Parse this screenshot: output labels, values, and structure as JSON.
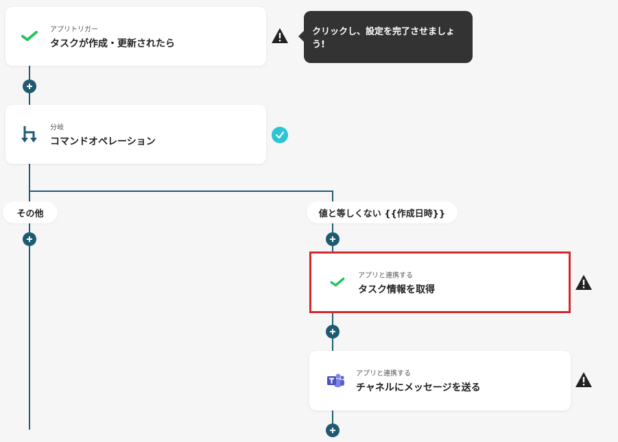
{
  "trigger": {
    "sublabel": "アプリトリガー",
    "title": "タスクが作成・更新されたら",
    "icon": "jooto-check-icon"
  },
  "tooltip": {
    "text": "クリックし、設定を完了させましょう!"
  },
  "branch": {
    "sublabel": "分岐",
    "title": "コマンドオペレーション",
    "icon": "branch-icon"
  },
  "branch_labels": {
    "other": "その他",
    "condition": "値と等しくない {{作成日時}}"
  },
  "step_get_task": {
    "sublabel": "アプリと連携する",
    "title": "タスク情報を取得",
    "icon": "jooto-check-icon"
  },
  "step_send_message": {
    "sublabel": "アプリと連携する",
    "title": "チャネルにメッセージを送る",
    "icon": "teams-icon"
  },
  "colors": {
    "line": "#1f5a73",
    "check": "#2bc5d4",
    "warning": "#222222",
    "selected_border": "#d0282b",
    "jooto_green": "#22c55e",
    "teams_purple": "#5b5fc7"
  }
}
